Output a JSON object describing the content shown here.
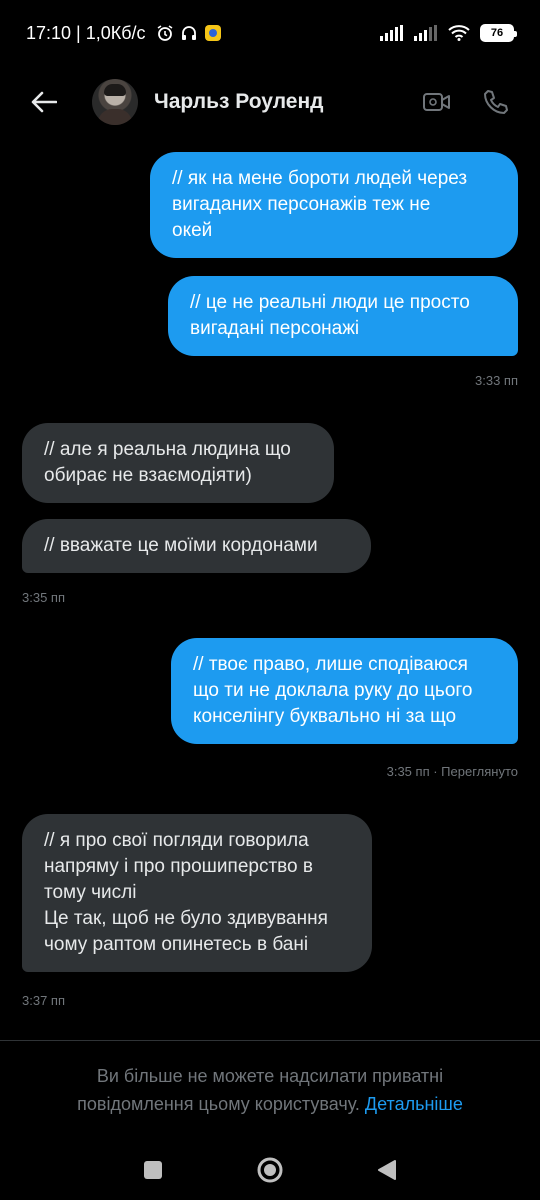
{
  "status_bar": {
    "time_speed": "17:10 | 1,0Кб/с",
    "battery": "76",
    "icons": [
      "alarm-icon",
      "headphones-icon",
      "app-notification-icon",
      "signal-icon",
      "wifi-icon",
      "battery-icon"
    ]
  },
  "header": {
    "contact_name": "Чарльз Роуленд",
    "icons": [
      "back-arrow-icon",
      "video-call-icon",
      "phone-call-icon"
    ]
  },
  "messages": [
    {
      "side": "out",
      "text": "// як на мене бороти людей через\nвигаданих персонажів теж не\nокей"
    },
    {
      "side": "out",
      "text": "// це не реальні люди це просто\nвигадані персонажі"
    },
    {
      "side": "out_meta",
      "text": "3:33 пп"
    },
    {
      "side": "in",
      "text": "// але я реальна людина що\nобирає не взаємодіяти)"
    },
    {
      "side": "in",
      "text": "// вважате це моїми кордонами"
    },
    {
      "side": "in_meta",
      "text": "3:35 пп"
    },
    {
      "side": "out",
      "text": "// твоє право, лише сподіваюся\nщо ти не доклала руку до цього\nконселінгу буквально ні за що"
    },
    {
      "side": "out_meta",
      "text": "3:35 пп · Переглянуто"
    },
    {
      "side": "in",
      "text": "// я про свої погляди говорила\nнапряму і про прошиперство в\nтому числі\nЦе так, щоб не було здивування\nчому раптом опинетесь в бані"
    },
    {
      "side": "in_meta",
      "text": "3:37 пп"
    }
  ],
  "footer": {
    "notice_text": "Ви більше не можете надсилати приватні повідомлення цьому користувачу. ",
    "notice_link": "Детальніше"
  },
  "colors": {
    "background": "#000000",
    "outgoing_bubble": "#1d9bf0",
    "incoming_bubble": "#2f3336",
    "meta_text": "#71767b",
    "link": "#1d9bf0"
  }
}
